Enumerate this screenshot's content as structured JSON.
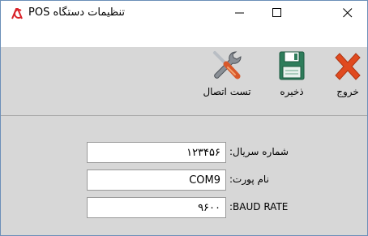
{
  "window": {
    "title": "تنظیمات دستگاه POS",
    "minimize_glyph": "—",
    "maximize_glyph": "☐",
    "close_glyph": "✕"
  },
  "toolbar": {
    "test_label": "تست اتصال",
    "save_label": "ذخیره",
    "exit_label": "خروج",
    "test_icon": "tools-icon",
    "save_icon": "floppy-disk-icon",
    "exit_icon": "red-x-icon"
  },
  "form": {
    "serial": {
      "label": "شماره سریال:",
      "value": "۱۲۳۴۵۶"
    },
    "port": {
      "label": "نام پورت:",
      "value": "COM9"
    },
    "baud": {
      "label": ":BAUD RATE",
      "value": "۹۶۰۰"
    }
  },
  "colors": {
    "toolbar_bg": "#d7d7d7",
    "logo_red": "#d9232a",
    "exit_red": "#e04a1f",
    "save_green": "#2e7d5b"
  }
}
